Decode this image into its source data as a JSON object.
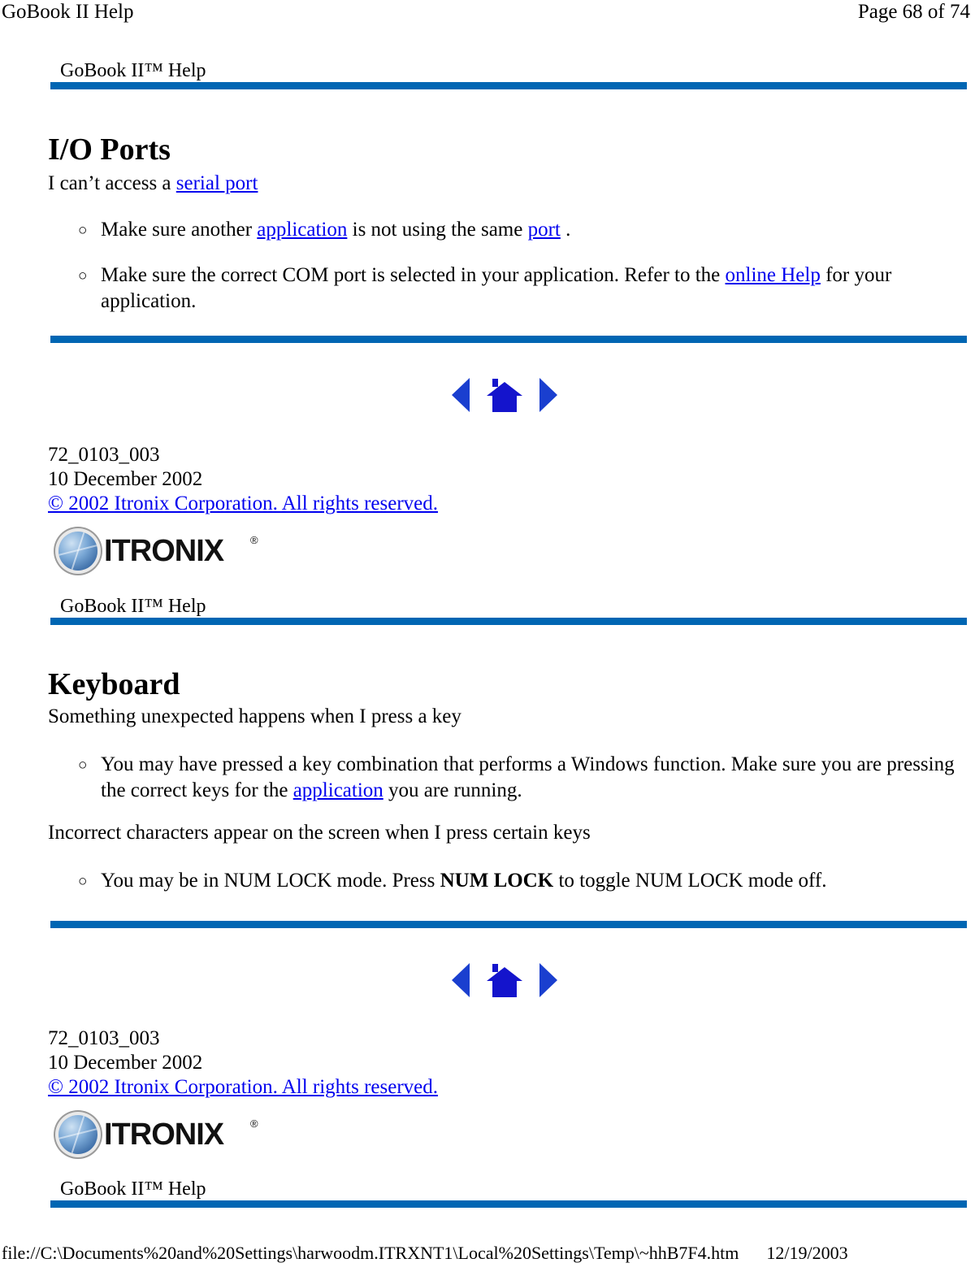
{
  "page_header": {
    "left_title": "GoBook II Help",
    "right_page": "Page 68 of 74"
  },
  "page_footer": {
    "file_path": "file://C:\\Documents%20and%20Settings\\harwoodm.ITRXNT1\\Local%20Settings\\Temp\\~hhB7F4.htm",
    "date": "12/19/2003"
  },
  "colors": {
    "rule_blue": "#0066b3",
    "link_blue": "#0000ee",
    "nav_blue": "#1414cc"
  },
  "banner": {
    "label": "GoBook II™ Help"
  },
  "icons": {
    "prev": "triangle-left-icon",
    "home": "home-icon",
    "next": "triangle-right-icon",
    "logo_globe": "itronix-globe-icon"
  },
  "logo": {
    "wordmark": "ITRONIX",
    "registered": "®"
  },
  "footer_block": {
    "doc_number": "72_0103_003",
    "doc_date": "10 December 2002",
    "copyright": "© 2002 Itronix Corporation.  All rights reserved."
  },
  "section_io": {
    "heading": "I/O Ports",
    "intro_before": "I can’t access a ",
    "intro_link": "serial port",
    "bullets": [
      {
        "marker": "○",
        "parts": [
          {
            "t": "Make sure another ",
            "link": false
          },
          {
            "t": "application",
            "link": true
          },
          {
            "t": " is not using the same ",
            "link": false
          },
          {
            "t": "port",
            "link": true
          },
          {
            "t": " .",
            "link": false
          }
        ]
      },
      {
        "marker": "○",
        "parts": [
          {
            "t": "Make sure the correct COM port is selected in your application. Refer to the ",
            "link": false
          },
          {
            "t": "online Help",
            "link": true
          },
          {
            "t": " for your application.",
            "link": false
          }
        ]
      }
    ]
  },
  "section_keyboard": {
    "heading": "Keyboard",
    "para1": "Something unexpected happens when I press a key",
    "bullet1": {
      "marker": "○",
      "parts": [
        {
          "t": "You may have pressed a key combination that performs a Windows function. Make sure you are pressing the correct keys for the ",
          "link": false
        },
        {
          "t": "application",
          "link": true
        },
        {
          "t": " you are running.",
          "link": false
        }
      ]
    },
    "para2": "Incorrect characters appear on the screen when I press certain keys",
    "bullet2": {
      "marker": "○",
      "parts": [
        {
          "t": "You may be in NUM LOCK mode. Press ",
          "link": false,
          "bold": false
        },
        {
          "t": "NUM LOCK",
          "link": false,
          "bold": true
        },
        {
          "t": " to toggle NUM LOCK mode off.",
          "link": false,
          "bold": false
        }
      ]
    }
  }
}
